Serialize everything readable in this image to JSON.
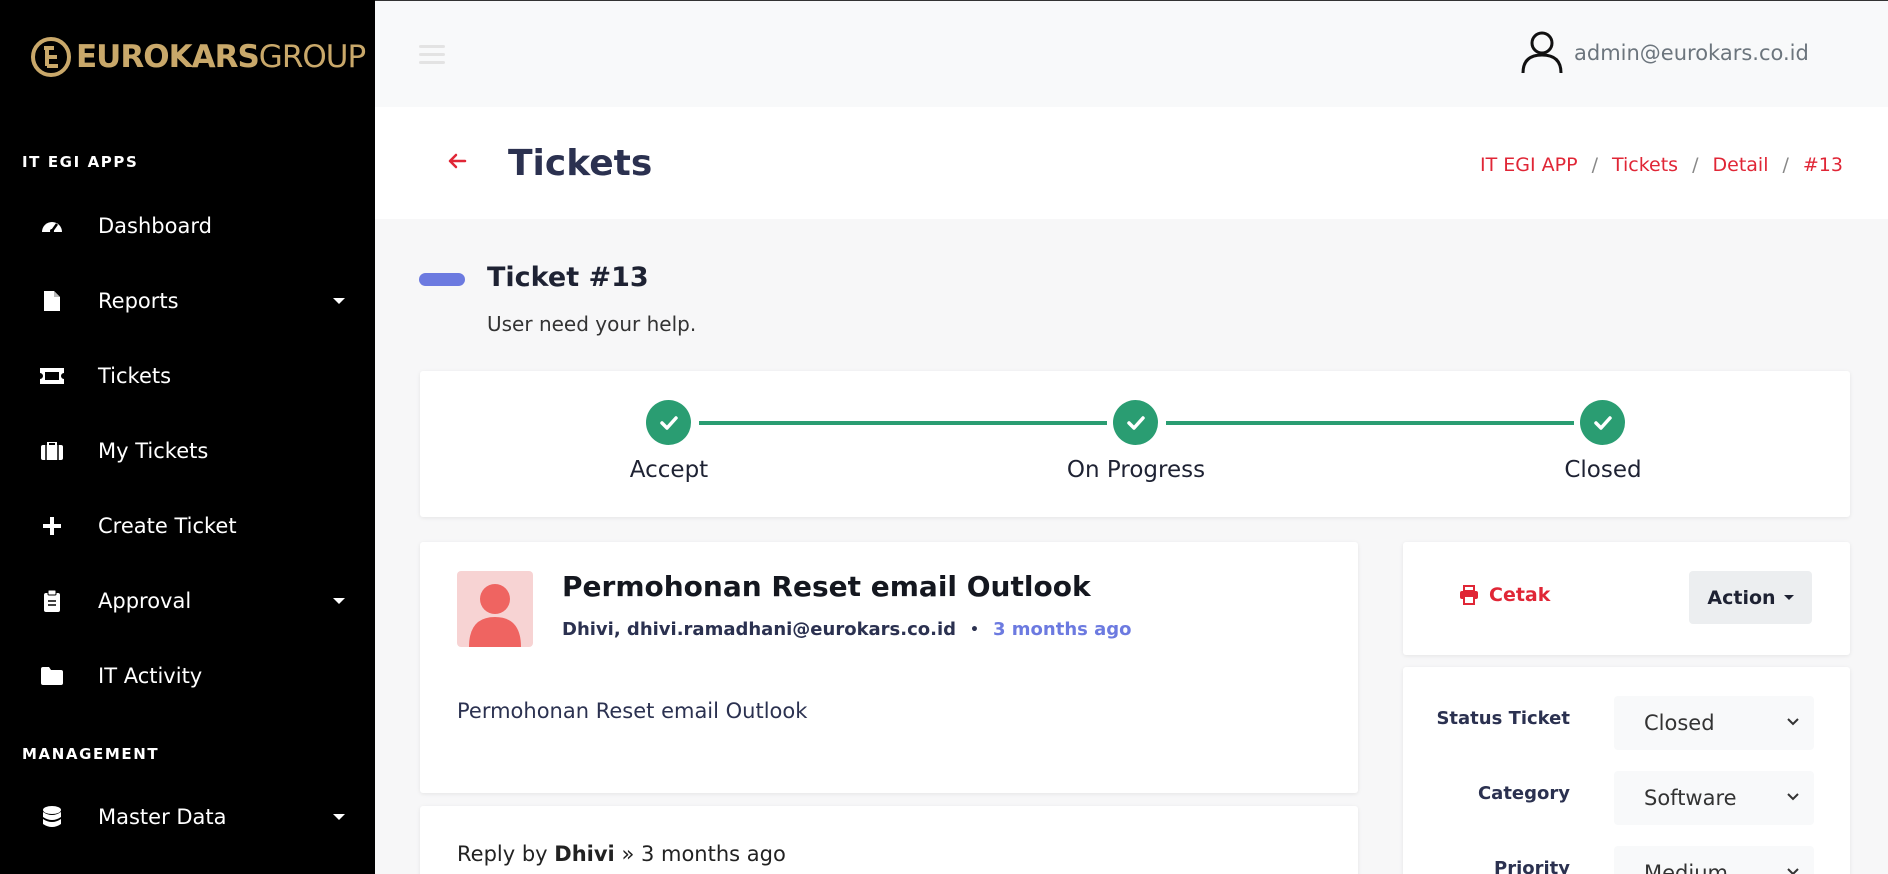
{
  "brand": {
    "name_bold": "EUROKARS",
    "name_light": "GROUP",
    "color": "#c9a86a"
  },
  "sidebar": {
    "section_apps": "IT EGI APPS",
    "section_management": "MANAGEMENT",
    "items": [
      {
        "label": "Dashboard",
        "icon": "tachometer-icon",
        "has_submenu": false
      },
      {
        "label": "Reports",
        "icon": "file-icon",
        "has_submenu": true
      },
      {
        "label": "Tickets",
        "icon": "ticket-icon",
        "has_submenu": false
      },
      {
        "label": "My Tickets",
        "icon": "briefcase-icon",
        "has_submenu": false
      },
      {
        "label": "Create Ticket",
        "icon": "plus-icon",
        "has_submenu": false
      },
      {
        "label": "Approval",
        "icon": "clipboard-check-icon",
        "has_submenu": true
      },
      {
        "label": "IT Activity",
        "icon": "folder-icon",
        "has_submenu": false
      }
    ],
    "management_items": [
      {
        "label": "Master Data",
        "icon": "database-icon",
        "has_submenu": true
      }
    ]
  },
  "topbar": {
    "user_email": "admin@eurokars.co.id"
  },
  "header": {
    "title": "Tickets",
    "breadcrumb": [
      "IT EGI APP",
      "Tickets",
      "Detail",
      "#13"
    ]
  },
  "ticket": {
    "heading": "Ticket #13",
    "subheading": "User need your help.",
    "steps": [
      "Accept",
      "On Progress",
      "Closed"
    ],
    "subject": "Permohonan Reset email Outlook",
    "requester": "Dhivi, dhivi.ramadhani@eurokars.co.id",
    "time_ago": "3 months ago",
    "body": "Permohonan Reset email Outlook",
    "reply": {
      "prefix": "Reply by",
      "author": "Dhivi",
      "suffix": "» 3 months ago"
    }
  },
  "actions": {
    "print_label": "Cetak",
    "action_label": "Action"
  },
  "form": {
    "status_label": "Status Ticket",
    "status_value": "Closed",
    "category_label": "Category",
    "category_value": "Software",
    "priority_label": "Priority",
    "priority_value": "Medium"
  },
  "colors": {
    "accent_red": "#e02636",
    "success_green": "#2a9d72",
    "indigo": "#6c7ae0"
  }
}
